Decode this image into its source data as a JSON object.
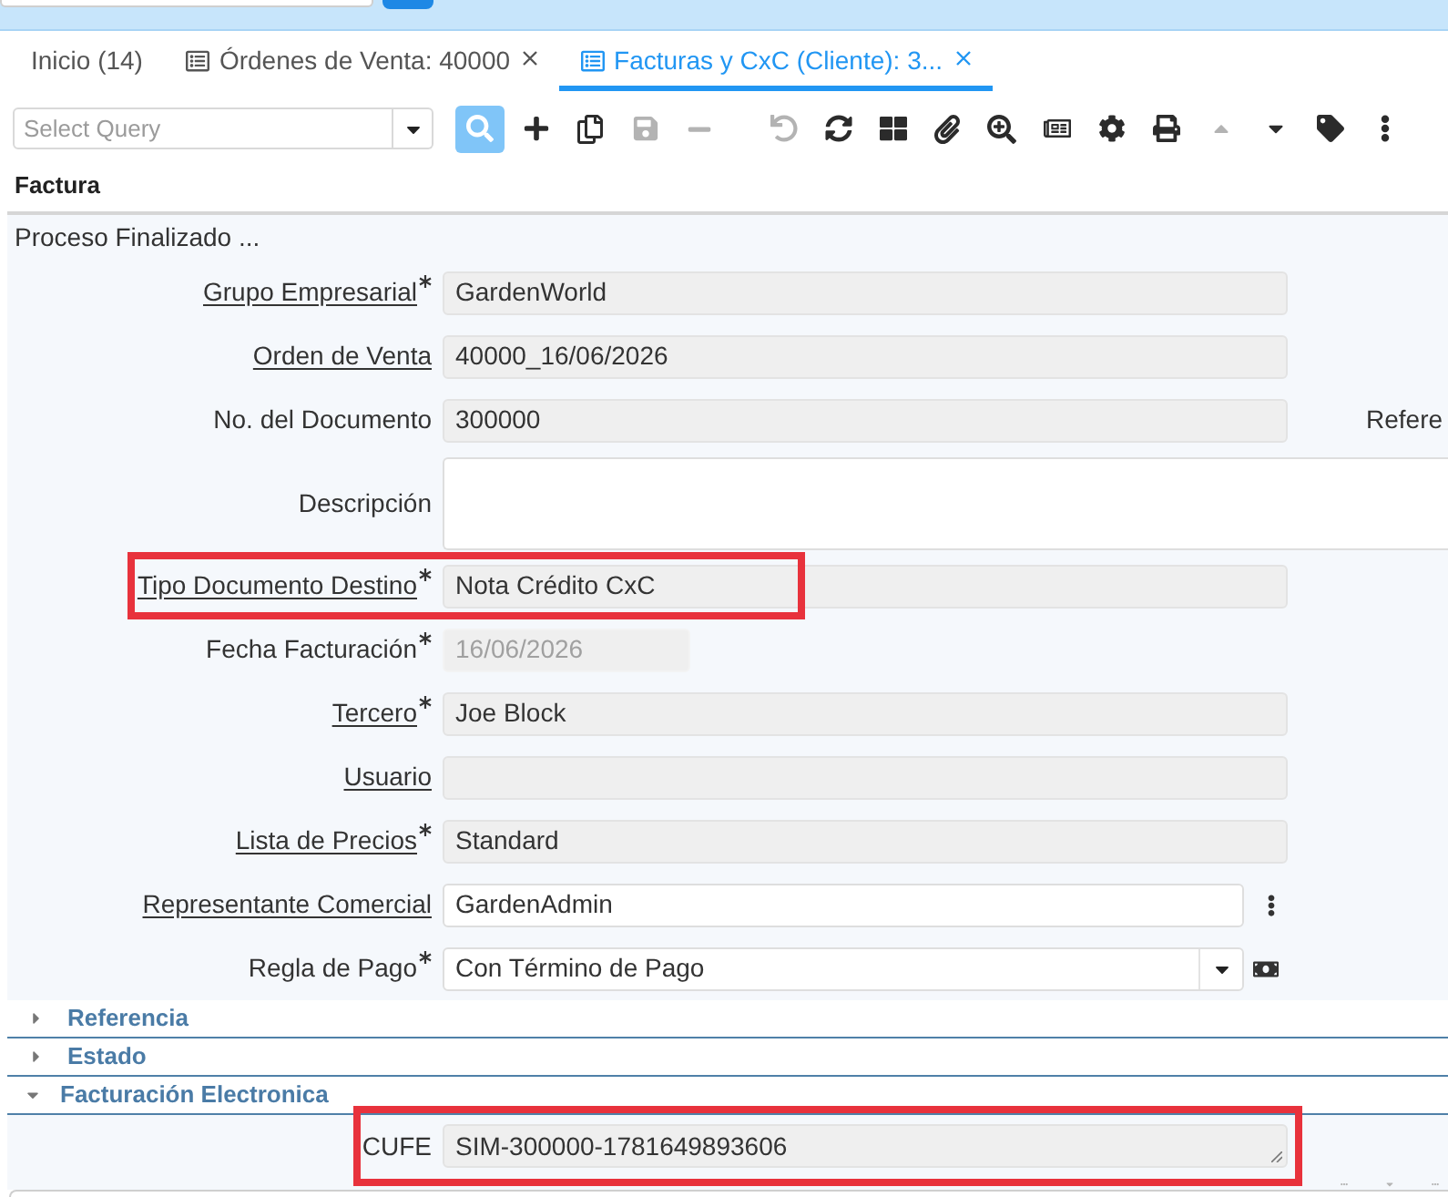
{
  "tabs": [
    {
      "label": "Inicio (14)",
      "selected": false,
      "has_icon": false,
      "closable": false
    },
    {
      "label": "Órdenes de Venta: 40000",
      "selected": false,
      "has_icon": true,
      "closable": true
    },
    {
      "label": "Facturas y CxC (Cliente): 3...",
      "selected": true,
      "has_icon": true,
      "closable": true
    }
  ],
  "query": {
    "placeholder": "Select Query"
  },
  "toolbar": [
    {
      "buttons": [
        {
          "kind": "search",
          "active": true,
          "disabled": false
        },
        {
          "kind": "new",
          "active": false,
          "disabled": false
        },
        {
          "kind": "copy",
          "active": false,
          "disabled": false
        },
        {
          "kind": "save",
          "active": false,
          "disabled": true
        },
        {
          "kind": "delete",
          "active": false,
          "disabled": true
        }
      ]
    },
    {
      "buttons": [
        {
          "kind": "undo",
          "active": false,
          "disabled": true
        },
        {
          "kind": "refresh",
          "active": false,
          "disabled": false
        },
        {
          "kind": "grid",
          "active": false,
          "disabled": false
        },
        {
          "kind": "attach",
          "active": false,
          "disabled": false
        },
        {
          "kind": "zoom",
          "active": false,
          "disabled": false
        },
        {
          "kind": "report",
          "active": false,
          "disabled": false
        },
        {
          "kind": "process",
          "active": false,
          "disabled": false
        },
        {
          "kind": "print",
          "active": false,
          "disabled": false
        },
        {
          "kind": "previous",
          "active": false,
          "disabled": true
        },
        {
          "kind": "next",
          "active": false,
          "disabled": false
        },
        {
          "kind": "tag",
          "active": false,
          "disabled": false
        },
        {
          "kind": "more",
          "active": false,
          "disabled": false
        }
      ]
    }
  ],
  "form": {
    "title": "Factura",
    "status": "Proceso Finalizado ...",
    "fields": [
      {
        "label": "Grupo Empresarial",
        "linked": true,
        "required": true,
        "kind": "text",
        "value": "GardenWorld",
        "readonly": true,
        "disabled": false,
        "highlighted": false
      },
      {
        "label": "Orden de Venta",
        "linked": true,
        "required": false,
        "kind": "text",
        "value": "40000_16/06/2026",
        "readonly": true,
        "disabled": false,
        "highlighted": false
      },
      {
        "label": "No. del Documento",
        "linked": false,
        "required": false,
        "kind": "text",
        "value": "300000",
        "readonly": true,
        "disabled": false,
        "highlighted": false,
        "side_label": "Refere"
      },
      {
        "label": "Descripción",
        "linked": false,
        "required": false,
        "kind": "textarea",
        "readonly": false,
        "disabled": false,
        "highlighted": false
      },
      {
        "label": "Tipo Documento Destino",
        "linked": true,
        "required": true,
        "kind": "text",
        "value": "Nota Crédito CxC",
        "readonly": true,
        "disabled": false,
        "highlighted": true
      },
      {
        "label": "Fecha Facturación",
        "linked": false,
        "required": true,
        "kind": "date",
        "value": "16/06/2026",
        "readonly": true,
        "disabled": true,
        "highlighted": false
      },
      {
        "label": "Tercero",
        "linked": true,
        "required": true,
        "kind": "text",
        "value": "Joe Block",
        "readonly": true,
        "disabled": false,
        "highlighted": false
      },
      {
        "label": "Usuario",
        "linked": true,
        "required": false,
        "kind": "text",
        "readonly": true,
        "disabled": false,
        "highlighted": false
      },
      {
        "label": "Lista de Precios",
        "linked": true,
        "required": true,
        "kind": "text",
        "value": "Standard",
        "readonly": true,
        "disabled": false,
        "highlighted": false
      },
      {
        "label": "Representante Comercial",
        "linked": true,
        "required": false,
        "kind": "lookup",
        "value": "GardenAdmin",
        "readonly": false,
        "disabled": false,
        "highlighted": false
      },
      {
        "label": "Regla de Pago",
        "linked": false,
        "required": true,
        "kind": "select",
        "value": "Con Término de Pago",
        "readonly": false,
        "disabled": false,
        "highlighted": false
      }
    ],
    "sections": [
      {
        "title": "Referencia",
        "expanded": false
      },
      {
        "title": "Estado",
        "expanded": false
      },
      {
        "title": "Facturación Electronica",
        "expanded": true,
        "fields": [
          {
            "label": "CUFE",
            "linked": false,
            "required": false,
            "kind": "memo",
            "value": "SIM-300000-1781649893606",
            "readonly": true,
            "disabled": false,
            "highlighted": true
          }
        ]
      }
    ]
  }
}
